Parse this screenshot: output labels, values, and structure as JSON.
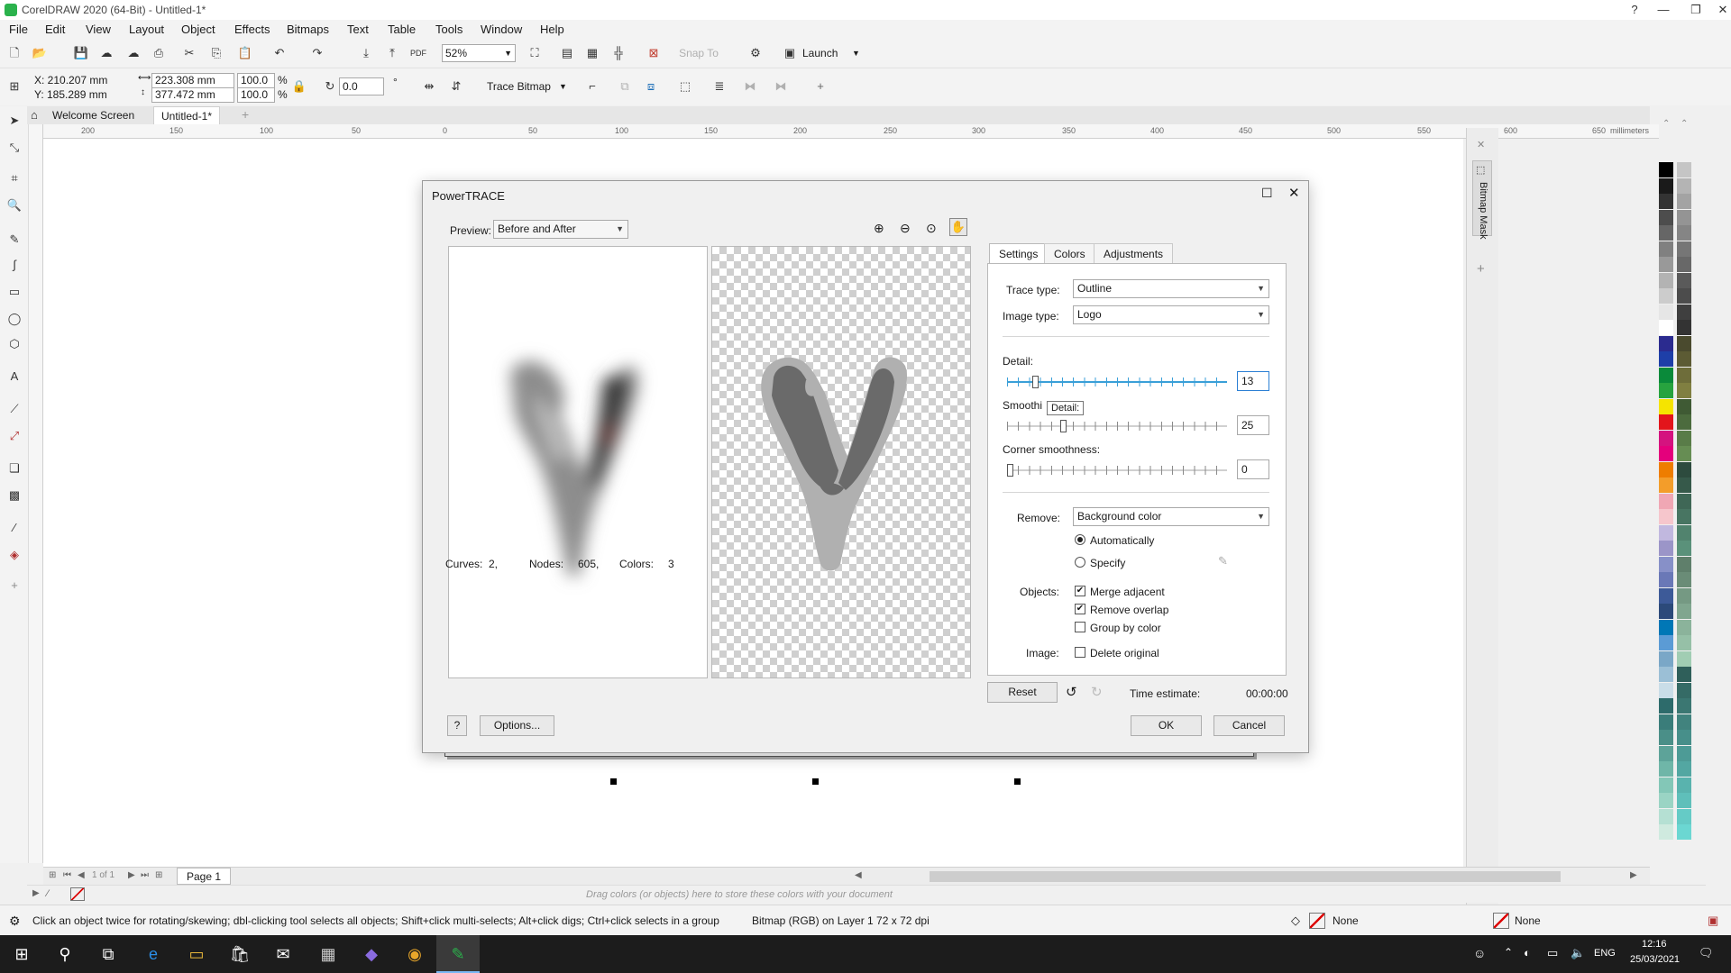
{
  "app": {
    "title": "CorelDRAW 2020 (64-Bit) - Untitled-1*"
  },
  "menu": [
    "File",
    "Edit",
    "View",
    "Layout",
    "Object",
    "Effects",
    "Bitmaps",
    "Text",
    "Table",
    "Tools",
    "Window",
    "Help"
  ],
  "toolbar": {
    "zoom": "52%",
    "snap": "Snap To",
    "launch": "Launch"
  },
  "props": {
    "x": "X: 210.207 mm",
    "y": "Y: 185.289 mm",
    "w": "223.308 mm",
    "h": "377.472 mm",
    "sx": "100.0",
    "sy": "100.0",
    "pct1": "%",
    "pct2": "%",
    "angle": "0.0",
    "deg": "°",
    "trace": "Trace Bitmap"
  },
  "tabs": {
    "welcome": "Welcome Screen",
    "doc": "Untitled-1*"
  },
  "ruler": {
    "ticks": [
      "200",
      "150",
      "100",
      "50",
      "0",
      "50",
      "100",
      "150",
      "200",
      "250",
      "300",
      "350",
      "400",
      "450",
      "500",
      "550",
      "600",
      "650"
    ],
    "unit": "millimeters"
  },
  "docker": {
    "mask": "Bitmap Mask"
  },
  "page": {
    "counter": "1 of 1",
    "tab": "Page 1"
  },
  "colorbar": {
    "hint": "Drag colors (or objects) here to store these colors with your document"
  },
  "status": {
    "hint": "Click an object twice for rotating/skewing; dbl-clicking tool selects all objects; Shift+click multi-selects; Alt+click digs; Ctrl+click selects in a group",
    "info": "Bitmap (RGB) on Layer 1 72 x 72 dpi",
    "fill": "None",
    "outline": "None"
  },
  "taskbar": {
    "time": "12:16",
    "date": "25/03/2021",
    "lang": "ENG"
  },
  "colors": {
    "palette": [
      "#000000",
      "#1a1a1a",
      "#333333",
      "#4d4d4d",
      "#666666",
      "#808080",
      "#999999",
      "#b3b3b3",
      "#cccccc",
      "#e6e6e6",
      "#ffffff",
      "#2b2b8f",
      "#1e3fa8",
      "#0a8a3a",
      "#27a33f",
      "#f5e400",
      "#e3151b",
      "#d4137f",
      "#e4007c",
      "#ee7d00",
      "#f39d2a",
      "#f0a7b4",
      "#f6c6cc",
      "#c1b8df",
      "#9b95c8",
      "#8790c8",
      "#6a78b7",
      "#3d5a98",
      "#2c4a7a",
      "#0077b6",
      "#5b9bd5",
      "#7aa7c7",
      "#9bbfd6",
      "#c9dde8",
      "#2d6b6b",
      "#3a7d7a",
      "#4a8f88",
      "#5da399",
      "#6fb6a8",
      "#83c7b7",
      "#9ad4c4",
      "#b5e0d3",
      "#cfeadf"
    ],
    "palette2": [
      "#c5c5c5",
      "#b4b4b4",
      "#a3a3a3",
      "#949494",
      "#858585",
      "#767676",
      "#686868",
      "#5a5a5a",
      "#4c4c4c",
      "#3f3f3f",
      "#333333",
      "#4a4a2e",
      "#5c5b34",
      "#6e6d3a",
      "#807f41",
      "#3f5a34",
      "#4c6b3e",
      "#597c48",
      "#668d53",
      "#2d4b3e",
      "#36594a",
      "#3f6756",
      "#487562",
      "#51836e",
      "#5a917a",
      "#5f7f6b",
      "#6a8c77",
      "#759983",
      "#80a68f",
      "#8bb39b",
      "#96c0a7",
      "#a1cdb3",
      "#2f5f5a",
      "#356b66",
      "#3b7772",
      "#41837e",
      "#478f8a",
      "#4d9b96",
      "#53a7a2",
      "#59b3ae",
      "#5fbfba",
      "#65cbc6",
      "#6bd7d2"
    ]
  },
  "dialog": {
    "title": "PowerTRACE",
    "preview_label": "Preview:",
    "preview_value": "Before and After",
    "tabs": [
      "Settings",
      "Colors",
      "Adjustments"
    ],
    "trace_type_label": "Trace type:",
    "trace_type": "Outline",
    "image_type_label": "Image type:",
    "image_type": "Logo",
    "detail_label": "Detail:",
    "detail_value": "13",
    "detail_pos": 0.12,
    "tooltip": "Detail:",
    "smoothing_label": "Smoothi",
    "smoothing_value": "25",
    "smoothing_pos": 0.25,
    "corner_label": "Corner smoothness:",
    "corner_value": "0",
    "corner_pos": 0,
    "remove_label": "Remove:",
    "remove_value": "Background color",
    "auto_label": "Automatically",
    "specify_label": "Specify",
    "objects_label": "Objects:",
    "merge": "Merge adjacent",
    "overlap": "Remove overlap",
    "group": "Group by color",
    "image_label": "Image:",
    "delete": "Delete original",
    "curves_label": "Curves:",
    "curves": "2,",
    "nodes_label": "Nodes:",
    "nodes": "605,",
    "colors_label": "Colors:",
    "colors": "3",
    "reset": "Reset",
    "time_label": "Time estimate:",
    "time": "00:00:00",
    "help": "?",
    "options": "Options...",
    "ok": "OK",
    "cancel": "Cancel"
  }
}
